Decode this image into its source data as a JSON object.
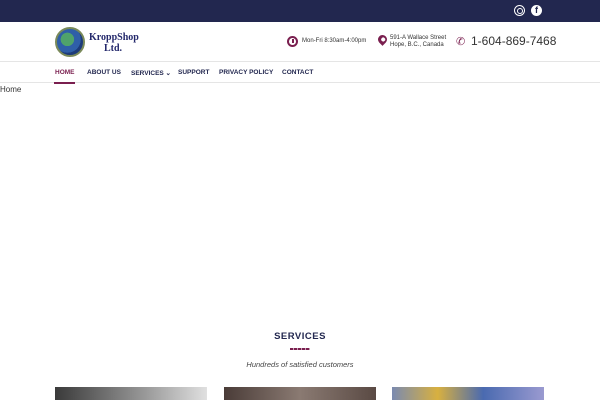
{
  "topbar": {
    "icons": [
      "instagram-icon",
      "facebook-icon"
    ],
    "facebook_glyph": "f",
    "bg_color": "#22274f"
  },
  "header": {
    "logo_line1": "KroppShop",
    "logo_line2": "Ltd.",
    "hours": "Mon-Fri 8:30am-4:00pm",
    "address_line1": "591-A Wallace Street",
    "address_line2": "Hope, B.C., Canada",
    "phone_glyph": "✆",
    "phone": "1-604-869-7468"
  },
  "nav": {
    "items": [
      {
        "label": "HOME"
      },
      {
        "label": "ABOUT US"
      },
      {
        "label": "SERVICES ⌄"
      },
      {
        "label": "SUPPORT"
      },
      {
        "label": "PRIVACY POLICY"
      },
      {
        "label": "CONTACT"
      }
    ],
    "accent_color": "#7a1f4f"
  },
  "breadcrumb": "Home",
  "services": {
    "title": "SERVICES",
    "subtitle": "Hundreds of satisfied customers"
  }
}
